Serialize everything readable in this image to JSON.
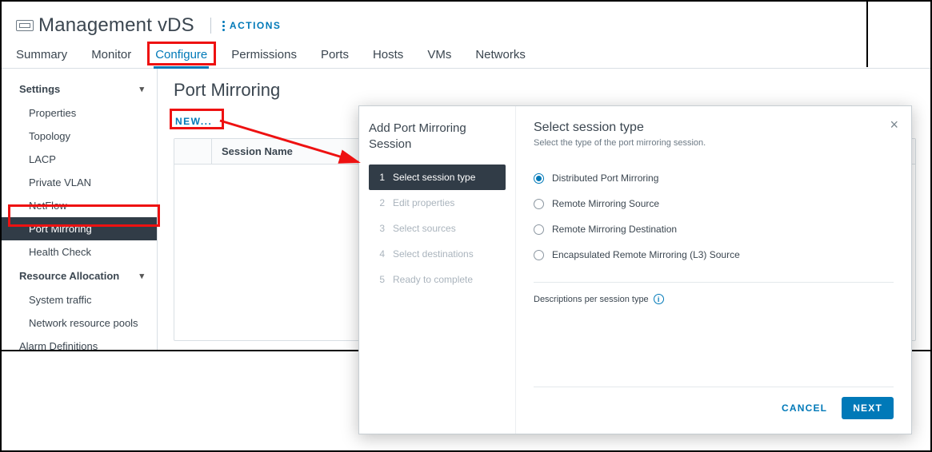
{
  "header": {
    "title": "Management vDS",
    "actions_label": "ACTIONS"
  },
  "tabs": [
    {
      "label": "Summary",
      "name": "tab-summary"
    },
    {
      "label": "Monitor",
      "name": "tab-monitor"
    },
    {
      "label": "Configure",
      "name": "tab-configure",
      "active": true
    },
    {
      "label": "Permissions",
      "name": "tab-permissions"
    },
    {
      "label": "Ports",
      "name": "tab-ports"
    },
    {
      "label": "Hosts",
      "name": "tab-hosts"
    },
    {
      "label": "VMs",
      "name": "tab-vms"
    },
    {
      "label": "Networks",
      "name": "tab-networks"
    }
  ],
  "sidenav": {
    "groups": [
      {
        "header": "Settings",
        "items": [
          {
            "label": "Properties",
            "name": "nav-properties"
          },
          {
            "label": "Topology",
            "name": "nav-topology"
          },
          {
            "label": "LACP",
            "name": "nav-lacp"
          },
          {
            "label": "Private VLAN",
            "name": "nav-private-vlan"
          },
          {
            "label": "NetFlow",
            "name": "nav-netflow"
          },
          {
            "label": "Port Mirroring",
            "name": "nav-port-mirroring",
            "active": true
          },
          {
            "label": "Health Check",
            "name": "nav-health-check"
          }
        ]
      },
      {
        "header": "Resource Allocation",
        "items": [
          {
            "label": "System traffic",
            "name": "nav-system-traffic"
          },
          {
            "label": "Network resource pools",
            "name": "nav-network-resource-pools"
          }
        ]
      }
    ],
    "flat_items": [
      {
        "label": "Alarm Definitions",
        "name": "nav-alarm-definitions"
      }
    ]
  },
  "content": {
    "title": "Port Mirroring",
    "new_label": "NEW...",
    "grid_column": "Session Name"
  },
  "modal": {
    "left_title": "Add Port Mirroring Session",
    "steps": [
      {
        "num": "1",
        "label": "Select session type",
        "active": true
      },
      {
        "num": "2",
        "label": "Edit properties"
      },
      {
        "num": "3",
        "label": "Select sources"
      },
      {
        "num": "4",
        "label": "Select destinations"
      },
      {
        "num": "5",
        "label": "Ready to complete"
      }
    ],
    "right_title": "Select session type",
    "right_sub": "Select the type of the port mirroring session.",
    "options": [
      {
        "label": "Distributed Port Mirroring",
        "checked": true
      },
      {
        "label": "Remote Mirroring Source"
      },
      {
        "label": "Remote Mirroring Destination"
      },
      {
        "label": "Encapsulated Remote Mirroring (L3) Source"
      }
    ],
    "desc_label": "Descriptions per session type",
    "cancel_label": "CANCEL",
    "next_label": "NEXT"
  }
}
